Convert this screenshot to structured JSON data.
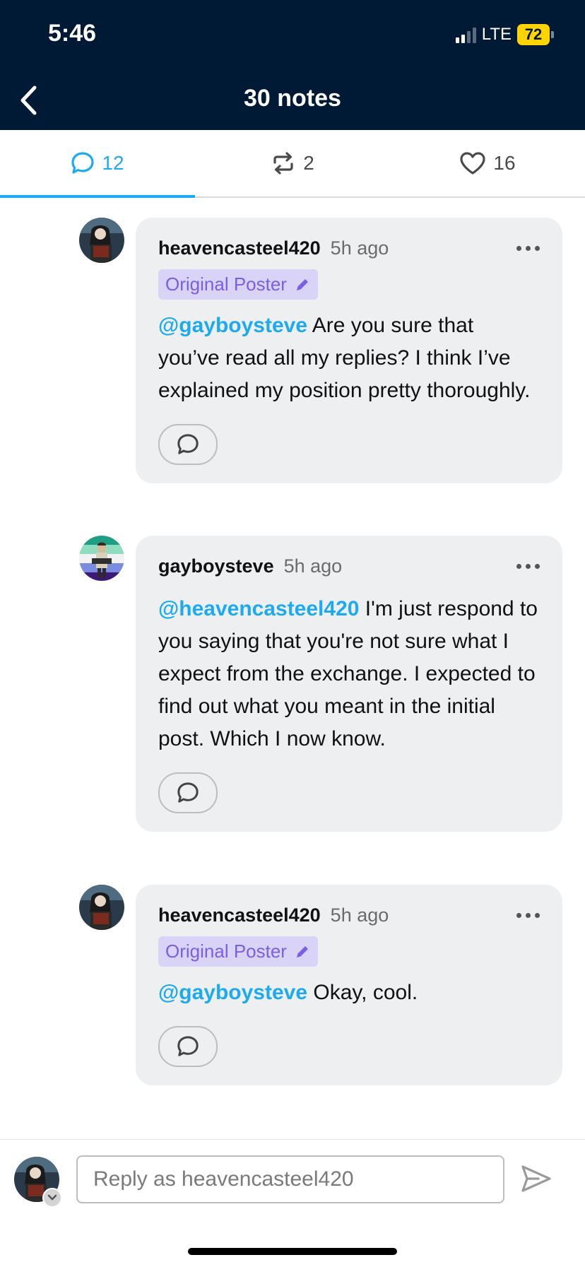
{
  "status_bar": {
    "time": "5:46",
    "network": "LTE",
    "battery": "72"
  },
  "header": {
    "title": "30 notes",
    "back_icon": "chevron-left-icon"
  },
  "tabs": [
    {
      "icon": "speech-bubble-icon",
      "count": "12",
      "active": true
    },
    {
      "icon": "reblog-icon",
      "count": "2",
      "active": false
    },
    {
      "icon": "heart-icon",
      "count": "16",
      "active": false
    }
  ],
  "notes": [
    {
      "username": "heavencasteel420",
      "time": "5h ago",
      "badge": "Original Poster",
      "mention": "@gayboysteve",
      "text": "Are you sure that you’ve read all my replies? I think I’ve explained my position pretty thoroughly."
    },
    {
      "username": "gayboysteve",
      "time": "5h ago",
      "badge": "",
      "mention": "@heavencasteel420",
      "text": "I'm just respond to you saying that you're not sure what I expect from the exchange. I expected to find out what you meant in the initial post. Which I now know."
    },
    {
      "username": "heavencasteel420",
      "time": "5h ago",
      "badge": "Original Poster",
      "mention": "@gayboysteve",
      "text": "Okay, cool."
    }
  ],
  "composer": {
    "placeholder": "Reply as heavencasteel420"
  },
  "colors": {
    "header_bg": "#001935",
    "accent": "#1eaaf1",
    "op_badge_bg": "#d9d3f7",
    "op_badge_text": "#7b5ee5",
    "bubble_bg": "#eeeff1"
  }
}
